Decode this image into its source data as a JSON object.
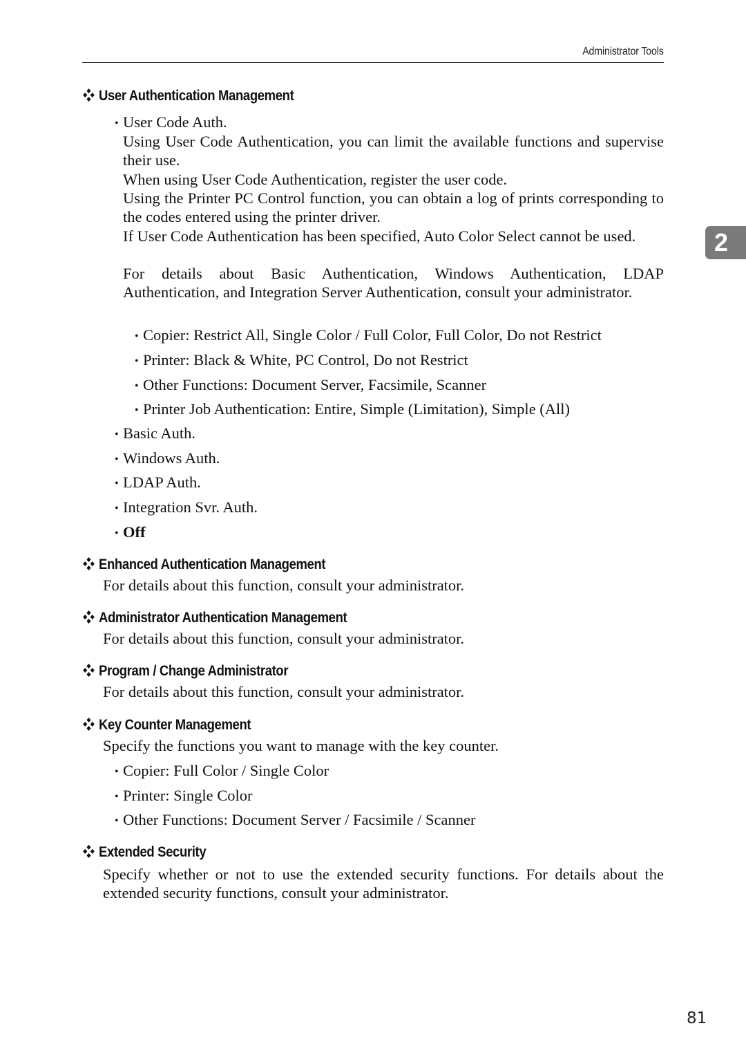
{
  "header": {
    "running_title": "Administrator Tools"
  },
  "chapter_tab": {
    "number": "2"
  },
  "sections": [
    {
      "heading": "User Authentication Management",
      "options": [
        {
          "label": "User Code Auth.",
          "description": [
            "Using User Code Authentication, you can limit the available functions and supervise their use.",
            "When using User Code Authentication, register the user code.",
            "Using the Printer PC Control function, you can obtain a log of prints corresponding to the codes entered using the printer driver.",
            "If User Code Authentication has been specified, Auto Color Select cannot be used.",
            "For details about Basic Authentication, Windows Authentication, LDAP Authentication, and Integration Server Authentication, consult your administrator."
          ],
          "sub_items": [
            "Copier: Restrict All, Single Color / Full Color, Full Color, Do not Restrict",
            "Printer: Black & White, PC Control, Do not Restrict",
            "Other Functions: Document Server, Facsimile, Scanner",
            "Printer Job Authentication: Entire, Simple (Limitation), Simple (All)"
          ]
        },
        {
          "label": "Basic Auth."
        },
        {
          "label": "Windows Auth."
        },
        {
          "label": "LDAP Auth."
        },
        {
          "label": "Integration Svr. Auth."
        },
        {
          "label": "Off",
          "is_default": true
        }
      ]
    },
    {
      "heading": "Enhanced Authentication Management",
      "body": "For details about this function, consult your administrator."
    },
    {
      "heading": "Administrator Authentication Management",
      "body": "For details about this function, consult your administrator."
    },
    {
      "heading": "Program / Change Administrator",
      "body": "For details about this function, consult your administrator."
    },
    {
      "heading": "Key Counter Management",
      "body": "Specify the functions you want to manage with the key counter.",
      "items": [
        "Copier: Full Color / Single Color",
        "Printer: Single Color",
        "Other Functions: Document Server / Facsimile / Scanner"
      ]
    },
    {
      "heading": "Extended Security",
      "body": "Specify whether or not to use the extended security functions. For details about the extended security functions, consult your administrator."
    }
  ],
  "footer": {
    "page_number": "81"
  }
}
